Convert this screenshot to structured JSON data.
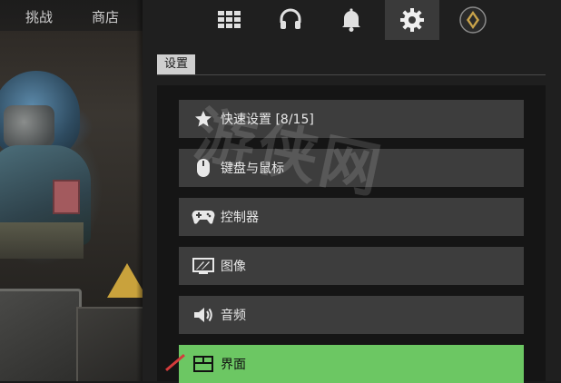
{
  "left_nav": {
    "tabs": [
      {
        "label": "挑战"
      },
      {
        "label": "商店"
      }
    ]
  },
  "top_icons": [
    {
      "name": "grid-icon"
    },
    {
      "name": "headset-icon"
    },
    {
      "name": "bell-icon"
    },
    {
      "name": "gear-icon",
      "active": true
    },
    {
      "name": "rank-badge-icon"
    }
  ],
  "section": {
    "title": "设置"
  },
  "menu": {
    "items": [
      {
        "label": "快速设置 [8/15]",
        "icon": "star-icon"
      },
      {
        "label": "键盘与鼠标",
        "icon": "mouse-icon"
      },
      {
        "label": "控制器",
        "icon": "gamepad-icon"
      },
      {
        "label": "图像",
        "icon": "display-icon"
      },
      {
        "label": "音频",
        "icon": "speaker-icon"
      },
      {
        "label": "界面",
        "icon": "interface-icon",
        "selected": true
      }
    ]
  },
  "watermark": {
    "text": "游侠网"
  },
  "colors": {
    "selected": "#6cc763",
    "item_bg": "#3d3d3d",
    "panel_bg": "#1f1f1f"
  }
}
